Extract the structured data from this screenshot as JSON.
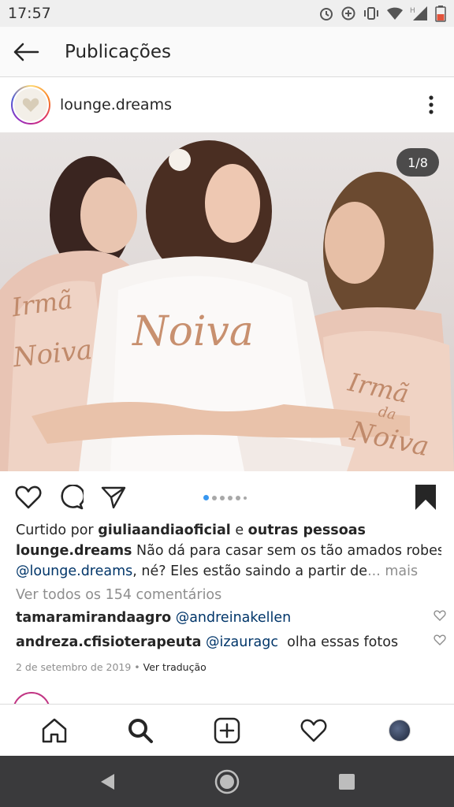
{
  "status_bar": {
    "time": "17:57"
  },
  "header": {
    "title": "Publicações"
  },
  "post": {
    "username": "lounge.dreams",
    "page_counter": "1/8",
    "photo_text_center": "Noiva",
    "photo_text_left_1": "Irmã",
    "photo_text_left_2": "Noiva",
    "photo_text_right_1": "Irmã",
    "photo_text_right_2": "da",
    "photo_text_right_3": "Noiva",
    "liked_prefix": "Curtido por ",
    "liked_user": "giuliaandiaoficial",
    "liked_and": " e ",
    "liked_others": "outras pessoas",
    "caption_user": "lounge.dreams",
    "caption_line1": " Não dá para casar sem os tão amados robes da",
    "caption_mention": "@lounge.dreams",
    "caption_line2": ", né? Eles estão saindo a partir de",
    "caption_more": "... mais",
    "view_comments": "Ver todos os 154 comentários",
    "comments": [
      {
        "user": "tamaramirandaagro",
        "mention": "@andreinakellen",
        "text": ""
      },
      {
        "user": "andreza.cfisioterapeuta",
        "mention": "@izauragc",
        "text": "olha essas fotos"
      }
    ],
    "date": "2 de setembro de 2019",
    "separator": " • ",
    "translate": "Ver tradução"
  },
  "colors": {
    "link": "#003569",
    "accent": "#3897f0",
    "muted": "#8e8e8e"
  },
  "icons": {
    "back": "arrow-left-icon",
    "more": "three-dots-vertical-icon",
    "like": "heart-icon",
    "comment": "comment-bubble-icon",
    "share": "paper-plane-icon",
    "save": "bookmark-filled-icon",
    "home": "home-icon",
    "search": "search-icon",
    "add": "plus-square-icon",
    "activity": "heart-icon",
    "profile": "avatar"
  }
}
